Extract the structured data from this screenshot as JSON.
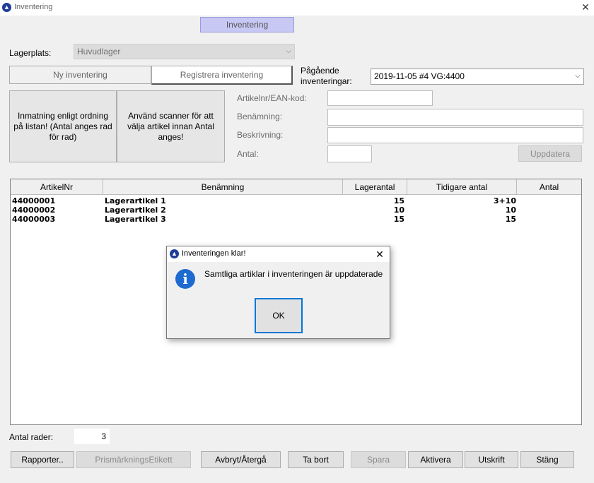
{
  "window": {
    "title": "Inventering",
    "close_glyph": "✕",
    "icon": "app-logo-icon"
  },
  "top_tab": {
    "label": "Inventering"
  },
  "lagerplats": {
    "label": "Lagerplats:",
    "value": "Huvudlager"
  },
  "mode_tabs": [
    {
      "label": "Ny inventering",
      "active": false
    },
    {
      "label": "Registrera inventering",
      "active": true
    }
  ],
  "pagaende": {
    "label": "Pågående inventeringar:",
    "value": "2019-11-05 #4 VG:4400"
  },
  "input_modes": [
    {
      "label": "Inmatning enligt ordning på listan! (Antal anges rad för rad)"
    },
    {
      "label": "Använd scanner för att välja artikel innan Antal anges!"
    }
  ],
  "form": {
    "artikelnr_label": "Artikelnr/EAN-kod:",
    "benamning_label": "Benämning:",
    "beskrivning_label": "Beskrivning:",
    "antal_label": "Antal:",
    "update_button": "Uppdatera"
  },
  "table": {
    "columns": [
      "ArtikelNr",
      "Benämning",
      "Lagerantal",
      "Tidigare antal",
      "Antal"
    ],
    "rows": [
      {
        "artikelnr": "44000001",
        "benamning": "Lagerartikel 1",
        "lagerantal": "15",
        "tidigare": "3+10",
        "antal": ""
      },
      {
        "artikelnr": "44000002",
        "benamning": "Lagerartikel 2",
        "lagerantal": "10",
        "tidigare": "10",
        "antal": ""
      },
      {
        "artikelnr": "44000003",
        "benamning": "Lagerartikel 3",
        "lagerantal": "15",
        "tidigare": "15",
        "antal": ""
      }
    ]
  },
  "row_count": {
    "label": "Antal rader:",
    "value": "3"
  },
  "buttons": {
    "rapporter": "Rapporter..",
    "prismarkning": "PrismärkningsEtikett",
    "avbryt": "Avbryt/Återgå",
    "ta_bort": "Ta bort",
    "spara": "Spara",
    "aktivera": "Aktivera",
    "utskrift": "Utskrift",
    "stang": "Stäng"
  },
  "dialog": {
    "title": "Inventeringen klar!",
    "message": "Samtliga artiklar i inventeringen är uppdaterade",
    "ok": "OK",
    "close_glyph": "✕",
    "icon": "info-icon"
  },
  "colors": {
    "accent_tab": "#c8c8f5",
    "focus_border": "#0078d7",
    "info_blue": "#1d6bd0"
  }
}
